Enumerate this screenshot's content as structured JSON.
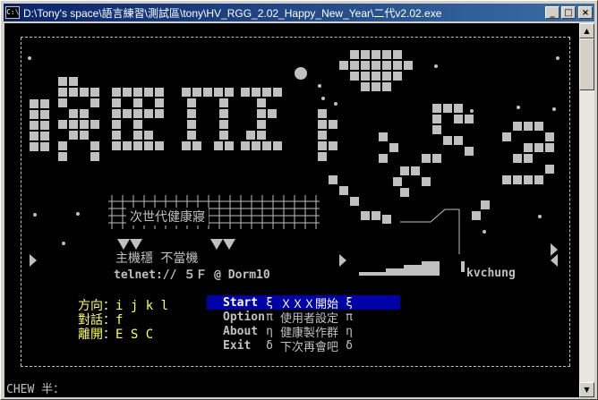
{
  "window": {
    "title": "D:\\Tony's space\\語言練習\\測試區\\tony\\HV_RGG_2.02_Happy_New_Year\\二代v2.02.exe",
    "icon": "console-icon",
    "buttons": {
      "minimize": "_",
      "maximize": "□",
      "close": "×"
    }
  },
  "banner": {
    "subtitle": "次世代健康寢",
    "line1": "主機穩  不當機",
    "telnet": "telnet:// ５Ｆ @ Dorm10",
    "author": "kvchung"
  },
  "keys": {
    "direction_label": "方向",
    "direction_value": "i j k l",
    "talk_label": "對話",
    "talk_value": "f",
    "exit_label": "離開",
    "exit_value": "E S C"
  },
  "menu": [
    {
      "key": "Start",
      "glyph1": "ξ",
      "label": "ＸＸＸ開始",
      "glyph2": "ξ",
      "selected": true
    },
    {
      "key": "Option",
      "glyph1": "π",
      "label": "使用者設定",
      "glyph2": "π",
      "selected": false
    },
    {
      "key": "About",
      "glyph1": "η",
      "label": "健康製作群",
      "glyph2": "η",
      "selected": false
    },
    {
      "key": "Exit",
      "glyph1": "δ",
      "label": "下次再會吧",
      "glyph2": "δ",
      "selected": false
    }
  ],
  "status": {
    "text": "CHEW 半："
  },
  "colors": {
    "titlebar_start": "#0a246a",
    "titlebar_end": "#3a6ea5",
    "console_bg": "#000000",
    "console_fg": "#c0c0c0",
    "highlight_key": "#ffff55",
    "menu_selected": "#0000a8"
  }
}
